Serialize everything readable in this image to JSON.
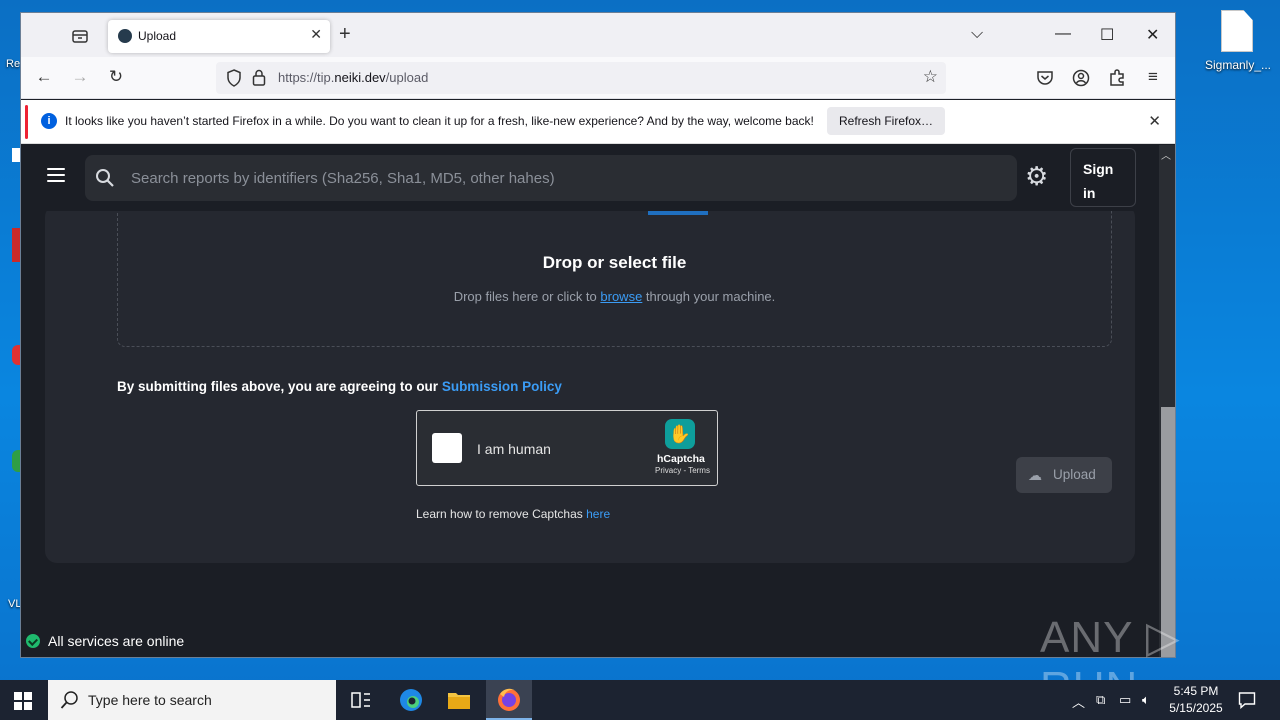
{
  "desktop": {
    "file_label": "Sigmanly_..."
  },
  "browser": {
    "tab_title": "Upload",
    "url_prefix": "https://tip.",
    "url_host": "neiki.dev",
    "url_path": "/upload",
    "notification": {
      "message": "It looks like you haven’t started Firefox in a while. Do you want to clean it up for a fresh, like-new experience? And by the way, welcome back!",
      "button": "Refresh Firefox…"
    }
  },
  "page": {
    "search_placeholder": "Search reports by identifiers (Sha256, Sha1, MD5, other hahes)",
    "sign_in": "Sign in",
    "drop_title": "Drop or select file",
    "drop_sub_before": "Drop files here or click to ",
    "drop_sub_link": "browse",
    "drop_sub_after": " through your machine.",
    "policy_text": "By submitting files above, you are agreeing to our ",
    "policy_link": "Submission Policy",
    "captcha_label": "I am human",
    "captcha_brand": "hCaptcha",
    "captcha_links": "Privacy - Terms",
    "learn_text": "Learn how to remove Captchas ",
    "learn_link": "here",
    "upload_label": "Upload",
    "status_text": "All services are online"
  },
  "watermark": "ANY ▷ RUN",
  "taskbar": {
    "search_placeholder": "Type here to search",
    "time": "5:45 PM",
    "date": "5/15/2025"
  },
  "colors": {
    "accent_link": "#3b9cf5",
    "status_ok": "#1fba6e",
    "page_bg": "#1b1e25"
  }
}
